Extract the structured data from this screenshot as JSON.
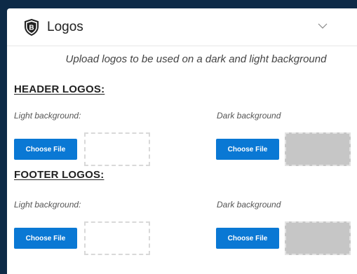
{
  "header": {
    "title": "Logos",
    "shield_icon": "shield-b-icon",
    "toggle_icon": "chevron-down-icon"
  },
  "subtitle": "Upload logos to be used on a dark and light background",
  "sections": [
    {
      "title": "HEADER LOGOS:",
      "light": {
        "label": "Light background:",
        "button": "Choose File"
      },
      "dark": {
        "label": "Dark background",
        "button": "Choose File"
      }
    },
    {
      "title": "FOOTER LOGOS:",
      "light": {
        "label": "Light background:",
        "button": "Choose File"
      },
      "dark": {
        "label": "Dark background",
        "button": "Choose File"
      }
    }
  ],
  "colors": {
    "page_bg": "#0d2a47",
    "button": "#0a78d4",
    "dark_preview": "#c6c6c6"
  }
}
